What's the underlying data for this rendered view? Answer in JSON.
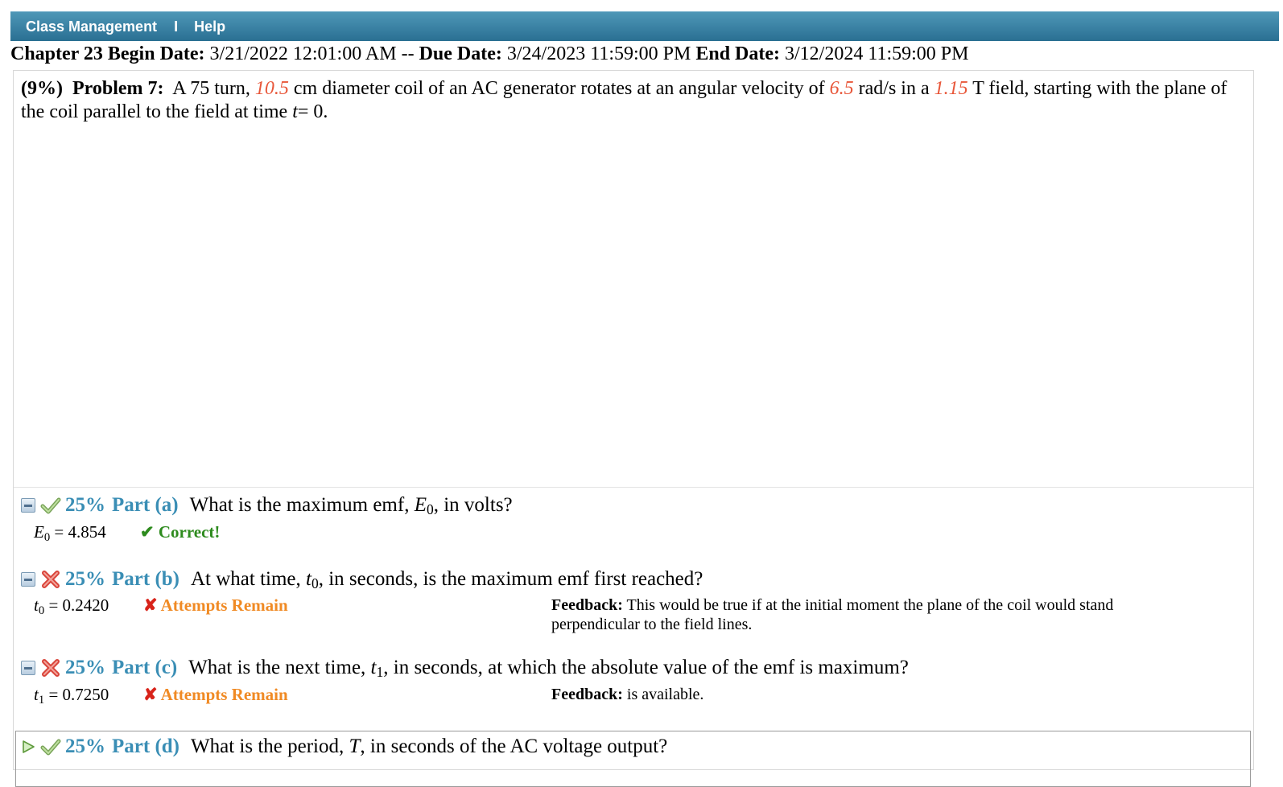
{
  "nav": {
    "class_management": "Class Management",
    "separator": "I",
    "help": "Help"
  },
  "dates": {
    "chapter": "Chapter 23",
    "begin_label": "Begin Date:",
    "begin_value": "3/21/2022 12:01:00 AM",
    "dash": "--",
    "due_label": "Due Date:",
    "due_value": "3/24/2023 11:59:00 PM",
    "end_label": "End Date:",
    "end_value": "3/12/2024 11:59:00 PM"
  },
  "problem": {
    "percent": "(9%)",
    "label": "Problem 7:",
    "text_1": "A 75 turn,",
    "value_diameter": "10.5",
    "text_2": "cm diameter coil of an AC generator rotates at an angular velocity of",
    "value_omega": "6.5",
    "text_3": "rad/s in a",
    "value_field": "1.15",
    "text_4": "T field, starting with the plane of the coil parallel to the field at time",
    "time_var": "t",
    "text_5": "= 0."
  },
  "parts": [
    {
      "percent": "25%",
      "label": "Part (a)",
      "question_pre": "What is the maximum emf,",
      "var": "E",
      "var_sub": "0",
      "question_post": ", in volts?",
      "answer_var": "E",
      "answer_sub": "0",
      "answer_value": "= 4.854",
      "status": "✔ Correct!"
    },
    {
      "percent": "25%",
      "label": "Part (b)",
      "question_pre": "At what time,",
      "var": "t",
      "var_sub": "0",
      "question_post": ", in seconds, is the maximum emf first reached?",
      "answer_var": "t",
      "answer_sub": "0",
      "answer_value": "= 0.2420",
      "status_mark": "✘",
      "status": "Attempts Remain",
      "feedback_label": "Feedback:",
      "feedback_text": "This would be true if at the initial moment the plane of the coil would stand perpendicular to the field lines."
    },
    {
      "percent": "25%",
      "label": "Part (c)",
      "question_pre": "What is the next time,",
      "var": "t",
      "var_sub": "1",
      "question_post": ", in seconds, at which the absolute value of the emf is maximum?",
      "answer_var": "t",
      "answer_sub": "1",
      "answer_value": "= 0.7250",
      "status_mark": "✘",
      "status": "Attempts Remain",
      "feedback_label": "Feedback:",
      "feedback_text": "is available."
    },
    {
      "percent": "25%",
      "label": "Part (d)",
      "question_pre": "What is the period,",
      "var": "T",
      "question_post": ", in seconds of the AC voltage output?"
    }
  ],
  "colors": {
    "navbar": "#2a6f92",
    "given_value": "#e8573a",
    "part_label": "#3a8eb5",
    "correct": "#2e8b1e",
    "attempts": "#f08a24",
    "wrong_mark": "#d8231a"
  }
}
